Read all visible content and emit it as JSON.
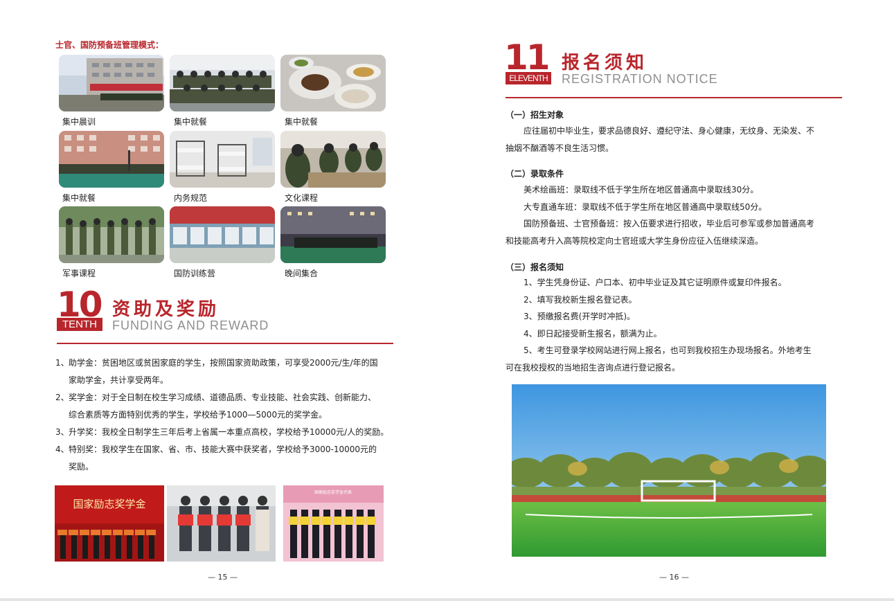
{
  "left_page": {
    "management_title": "士官、国防预备班管理模式：",
    "photo_captions": [
      "集中晨训",
      "集中就餐",
      "集中就餐",
      "集中就餐",
      "内务规范",
      "文化课程",
      "军事课程",
      "国防训练营",
      "晚间集合"
    ],
    "section": {
      "number": "10",
      "tag": "TENTH",
      "title_cn": "资助及奖励",
      "title_en": "FUNDING AND REWARD"
    },
    "funding_items": [
      {
        "num": "1、",
        "lines": [
          "助学金：贫困地区或贫困家庭的学生，按照国家资助政策，可享受2000元/生/年的国",
          "家助学金，共计享受两年。"
        ]
      },
      {
        "num": "2、",
        "lines": [
          "奖学金：对于全日制在校生学习成绩、道德品质、专业技能、社会实践、创新能力、",
          "综合素质等方面特别优秀的学生，学校给予1000—5000元的奖学金。"
        ]
      },
      {
        "num": "3、",
        "lines": [
          "升学奖：我校全日制学生三年后考上省属一本重点高校，学校给予10000元/人的奖励。"
        ]
      },
      {
        "num": "4、",
        "lines": [
          "特别奖：我校学生在国家、省、市、技能大赛中获奖者，学校给予3000-10000元的",
          "奖励。"
        ]
      }
    ],
    "award_banner_text": "国家励志奖学金",
    "award_photo3_text": "国家励志奖学金代表",
    "page_number": "— 15 —"
  },
  "right_page": {
    "section": {
      "number": "11",
      "tag": "ELEVENTH",
      "title_cn": "报名须知",
      "title_en": "REGISTRATION NOTICE"
    },
    "s1_title": "（一）招生对象",
    "s1_lines": [
      "应往届初中毕业生，要求品德良好、遵纪守法、身心健康，无纹身、无染发、不",
      "抽烟不酗酒等不良生活习惯。"
    ],
    "s2_title": "（二）录取条件",
    "s2_lines": [
      "美术绘画班：录取线不低于学生所在地区普通高中录取线30分。",
      "大专直通车班：录取线不低于学生所在地区普通高中录取线50分。",
      "国防预备班、士官预备班：按入伍要求进行招收，毕业后可参军或参加普通高考",
      "和技能高考升入高等院校定向士官班或大学生身份应征入伍继续深造。"
    ],
    "s3_title": "（三）报名须知",
    "s3_lines": [
      "1、学生凭身份证、户口本、初中毕业证及其它证明原件或复印件报名。",
      "2、填写我校新生报名登记表。",
      "3、预缴报名费(开学时冲抵)。",
      "4、即日起接受新生报名，额满为止。",
      "5、考生可登录学校网站进行网上报名，也可到我校招生办现场报名。外地考生",
      "可在我校授权的当地招生咨询点进行登记报名。"
    ],
    "page_number": "— 16 —"
  },
  "colors": {
    "accent": "#b8262c",
    "subtitle_gray": "#8f8f8f"
  }
}
